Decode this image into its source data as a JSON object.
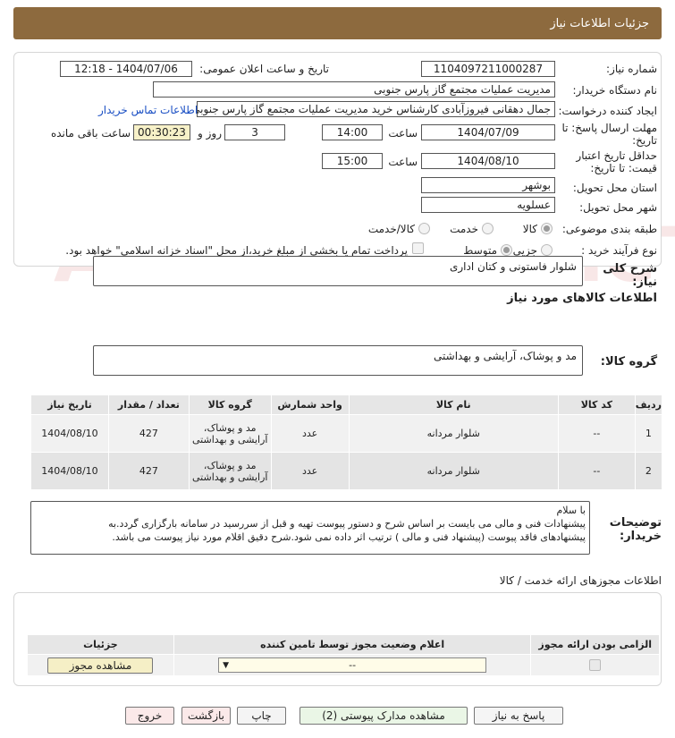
{
  "header": {
    "title": "جزئیات اطلاعات نیاز"
  },
  "form": {
    "need_number_label": "شماره نیاز:",
    "need_number": "1104097211000287",
    "announce_label": "تاریخ و ساعت اعلان عمومی:",
    "announce_value": "1404/07/06 - 12:18",
    "buyer_label": "نام دستگاه خریدار:",
    "buyer_value": "مدیریت عملیات مجتمع گاز پارس جنوبی",
    "creator_label": "ایجاد کننده درخواست:",
    "creator_value": "جمال دهقانی فیروزآبادی کارشناس خرید مدیریت عملیات مجتمع گاز پارس جنوبی",
    "contact_link": "اطلاعات تماس خریدار",
    "deadline_label_1": "مهلت ارسال پاسخ: تا",
    "deadline_label_2": "تاریخ:",
    "deadline_date": "1404/07/09",
    "time_label": "ساعت",
    "deadline_time": "14:00",
    "days_value": "3",
    "days_label": "روز و",
    "remaining_value": "00:30:23",
    "remaining_label": "ساعت باقی مانده",
    "validity_label_1": "حداقل تاریخ اعتبار",
    "validity_label_2": "قیمت: تا تاریخ:",
    "validity_date": "1404/08/10",
    "validity_time": "15:00",
    "province_label": "استان محل تحویل:",
    "province_value": "بوشهر",
    "city_label": "شهر محل تحویل:",
    "city_value": "عسلویه",
    "category_label": "طبقه بندی موضوعی:",
    "category_options": [
      "کالا",
      "خدمت",
      "کالا/خدمت"
    ],
    "process_label": "نوع فرآیند خرید :",
    "process_options": [
      "جزیی",
      "متوسط"
    ],
    "payment_note": "پرداخت تمام یا بخشی از مبلغ خرید،از محل \"اسناد خزانه اسلامی\" خواهد بود."
  },
  "summary": {
    "label": "شرح کلی نیاز:",
    "value": "شلوار فاستونی و کتان اداری"
  },
  "goods": {
    "title": "اطلاعات کالاهای مورد نیاز",
    "group_label": "گروه کالا:",
    "group_value": "مد و پوشاک، آرایشی و بهداشتی",
    "columns": [
      "ردیف",
      "کد کالا",
      "نام کالا",
      "واحد شمارش",
      "گروه کالا",
      "تعداد / مقدار",
      "تاریخ نیاز"
    ],
    "rows": [
      {
        "row": "1",
        "code": "--",
        "name": "شلوار مردانه",
        "unit": "عدد",
        "group": "مد و پوشاک، آرایشی و بهداشتی",
        "qty": "427",
        "date": "1404/08/10"
      },
      {
        "row": "2",
        "code": "--",
        "name": "شلوار مردانه",
        "unit": "عدد",
        "group": "مد و پوشاک، آرایشی و بهداشتی",
        "qty": "427",
        "date": "1404/08/10"
      }
    ]
  },
  "buyer_notes": {
    "label_1": "توضیحات",
    "label_2": "خریدار:",
    "line_1": "با سلام",
    "line_2": "پیشنهادات فنی و مالی می بایست بر اساس شرح و دستور پیوست تهیه و قبل از سررسید در سامانه بارگزاری گردد.به",
    "line_3": "پیشنهادهای فاقد پیوست (پیشنهاد فنی و مالی ) ترتیب اثر داده نمی شود.شرح دقیق اقلام مورد نیاز پیوست می باشد."
  },
  "permits": {
    "title": "اطلاعات مجوزهای ارائه خدمت / کالا",
    "col_required": "الزامی بودن ارائه مجوز",
    "col_status": "اعلام وضعیت مجوز توسط تامین کننده",
    "col_details": "جزئیات",
    "select_value": "--",
    "view_button": "مشاهده مجوز"
  },
  "buttons": {
    "reply": "پاسخ به نیاز",
    "docs": "مشاهده مدارک پیوستی (2)",
    "print": "چاپ",
    "back": "بازگشت",
    "exit": "خروج"
  },
  "watermark": {
    "text": "AriaTender.neT"
  }
}
